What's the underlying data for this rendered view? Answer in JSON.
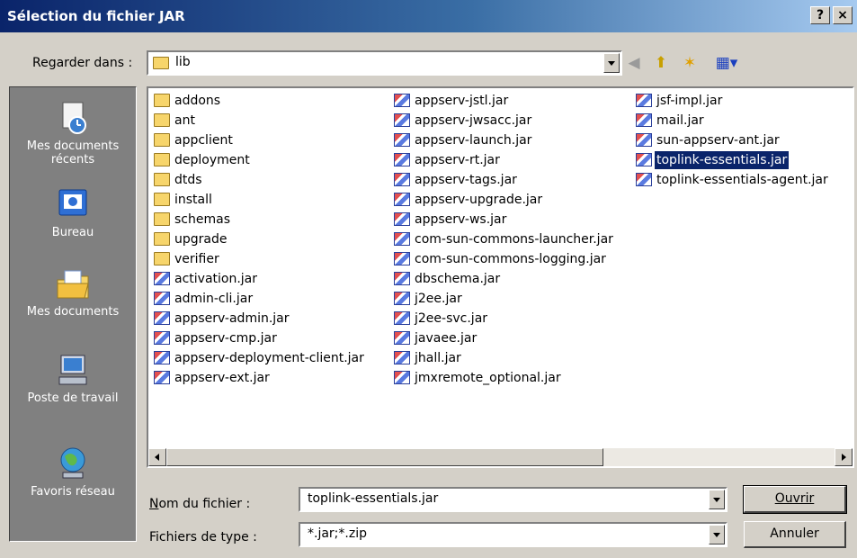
{
  "window": {
    "title": "Sélection du fichier JAR",
    "help_label": "?",
    "close_label": "×"
  },
  "lookin": {
    "label": "Regarder dans :",
    "value": "lib"
  },
  "toolbar": {
    "back_icon": "back-arrow-icon",
    "up_icon": "up-folder-icon",
    "newfolder_icon": "new-folder-icon",
    "views_icon": "views-menu-icon"
  },
  "places": [
    {
      "label": "Mes documents récents",
      "icon": "recent-documents-icon"
    },
    {
      "label": "Bureau",
      "icon": "desktop-icon"
    },
    {
      "label": "Mes documents",
      "icon": "my-documents-icon"
    },
    {
      "label": "Poste de travail",
      "icon": "my-computer-icon"
    },
    {
      "label": "Favoris réseau",
      "icon": "network-places-icon"
    }
  ],
  "files": {
    "col1": [
      {
        "name": "addons",
        "type": "folder"
      },
      {
        "name": "ant",
        "type": "folder"
      },
      {
        "name": "appclient",
        "type": "folder"
      },
      {
        "name": "deployment",
        "type": "folder"
      },
      {
        "name": "dtds",
        "type": "folder"
      },
      {
        "name": "install",
        "type": "folder"
      },
      {
        "name": "schemas",
        "type": "folder"
      },
      {
        "name": "upgrade",
        "type": "folder"
      },
      {
        "name": "verifier",
        "type": "folder"
      },
      {
        "name": "activation.jar",
        "type": "jar"
      },
      {
        "name": "admin-cli.jar",
        "type": "jar"
      },
      {
        "name": "appserv-admin.jar",
        "type": "jar"
      },
      {
        "name": "appserv-cmp.jar",
        "type": "jar"
      },
      {
        "name": "appserv-deployment-client.jar",
        "type": "jar"
      },
      {
        "name": "appserv-ext.jar",
        "type": "jar"
      }
    ],
    "col2": [
      {
        "name": "appserv-jstl.jar",
        "type": "jar"
      },
      {
        "name": "appserv-jwsacc.jar",
        "type": "jar"
      },
      {
        "name": "appserv-launch.jar",
        "type": "jar"
      },
      {
        "name": "appserv-rt.jar",
        "type": "jar"
      },
      {
        "name": "appserv-tags.jar",
        "type": "jar"
      },
      {
        "name": "appserv-upgrade.jar",
        "type": "jar"
      },
      {
        "name": "appserv-ws.jar",
        "type": "jar"
      },
      {
        "name": "com-sun-commons-launcher.jar",
        "type": "jar"
      },
      {
        "name": "com-sun-commons-logging.jar",
        "type": "jar"
      },
      {
        "name": "dbschema.jar",
        "type": "jar"
      },
      {
        "name": "j2ee.jar",
        "type": "jar"
      },
      {
        "name": "j2ee-svc.jar",
        "type": "jar"
      },
      {
        "name": "javaee.jar",
        "type": "jar"
      },
      {
        "name": "jhall.jar",
        "type": "jar"
      },
      {
        "name": "jmxremote_optional.jar",
        "type": "jar"
      }
    ],
    "col3": [
      {
        "name": "jsf-impl.jar",
        "type": "jar"
      },
      {
        "name": "mail.jar",
        "type": "jar"
      },
      {
        "name": "sun-appserv-ant.jar",
        "type": "jar"
      },
      {
        "name": "toplink-essentials.jar",
        "type": "jar",
        "selected": true
      },
      {
        "name": "toplink-essentials-agent.jar",
        "type": "jar"
      }
    ]
  },
  "filename": {
    "label": "Nom du fichier :",
    "value": "toplink-essentials.jar"
  },
  "filetype": {
    "label": "Fichiers de type :",
    "value": "*.jar;*.zip"
  },
  "buttons": {
    "open": "Ouvrir",
    "cancel": "Annuler"
  },
  "colors": {
    "selection": "#0a246a",
    "places_bg": "#808080",
    "dialog_bg": "#d4d0c8"
  }
}
